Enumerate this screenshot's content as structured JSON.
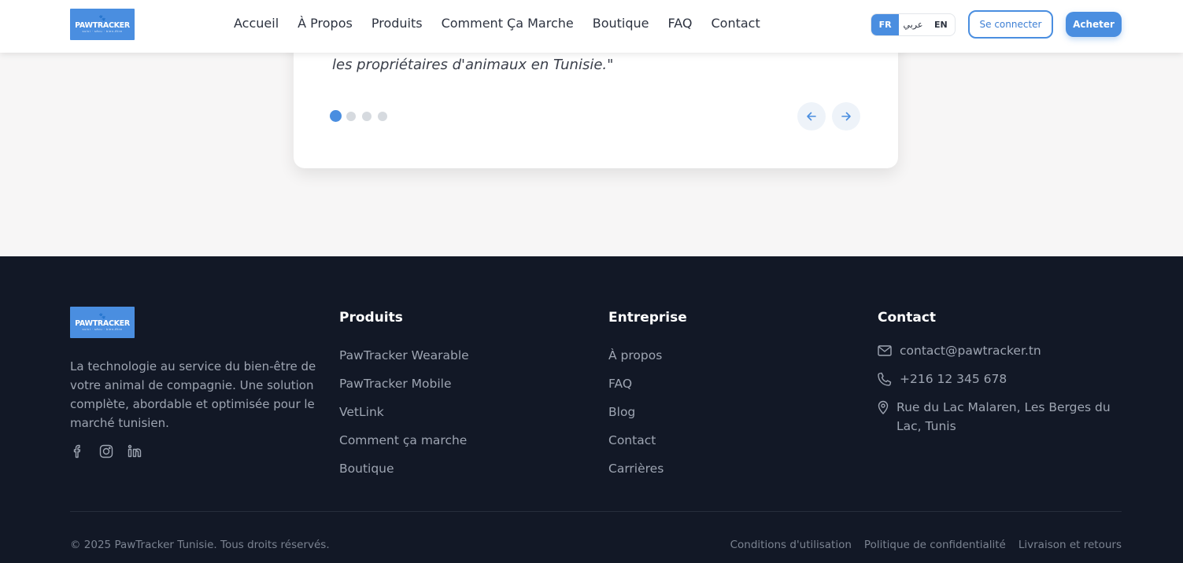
{
  "header": {
    "logo": {
      "brand": "PAWTRACKER",
      "tagline": "suivi · sécu · bien-être"
    },
    "nav": [
      "Accueil",
      "À Propos",
      "Produits",
      "Comment Ça Marche",
      "Boutique",
      "FAQ",
      "Contact"
    ],
    "languages": {
      "fr": "FR",
      "ar": "عربي",
      "en": "EN",
      "active": "FR"
    },
    "login_label": "Se connecter",
    "buy_label": "Acheter"
  },
  "testimonial": {
    "quote_tail": "les propriétaires d'animaux en Tunisie.\"",
    "total_slides": 4,
    "active_slide": 1
  },
  "footer": {
    "logo": {
      "brand": "PAWTRACKER",
      "tagline": "suivi · sécu · bien-être"
    },
    "about": "La technologie au service du bien-être de votre animal de compagnie. Une solution complète, abordable et optimisée pour le marché tunisien.",
    "social": [
      "facebook-icon",
      "instagram-icon",
      "linkedin-icon"
    ],
    "products": {
      "title": "Produits",
      "links": [
        "PawTracker Wearable",
        "PawTracker Mobile",
        "VetLink",
        "Comment ça marche",
        "Boutique"
      ]
    },
    "company": {
      "title": "Entreprise",
      "links": [
        "À propos",
        "FAQ",
        "Blog",
        "Contact",
        "Carrières"
      ]
    },
    "contact": {
      "title": "Contact",
      "email": "contact@pawtracker.tn",
      "phone": "+216 12 345 678",
      "address": "Rue du Lac Malaren, Les Berges du Lac, Tunis"
    },
    "copyright": "© 2025 PawTracker Tunisie. Tous droits réservés.",
    "legal": [
      "Conditions d'utilisation",
      "Politique de confidentialité",
      "Livraison et retours"
    ]
  },
  "colors": {
    "accent": "#4a8ee0",
    "footer_bg": "#121826",
    "page_bg": "#f7f6f6"
  }
}
